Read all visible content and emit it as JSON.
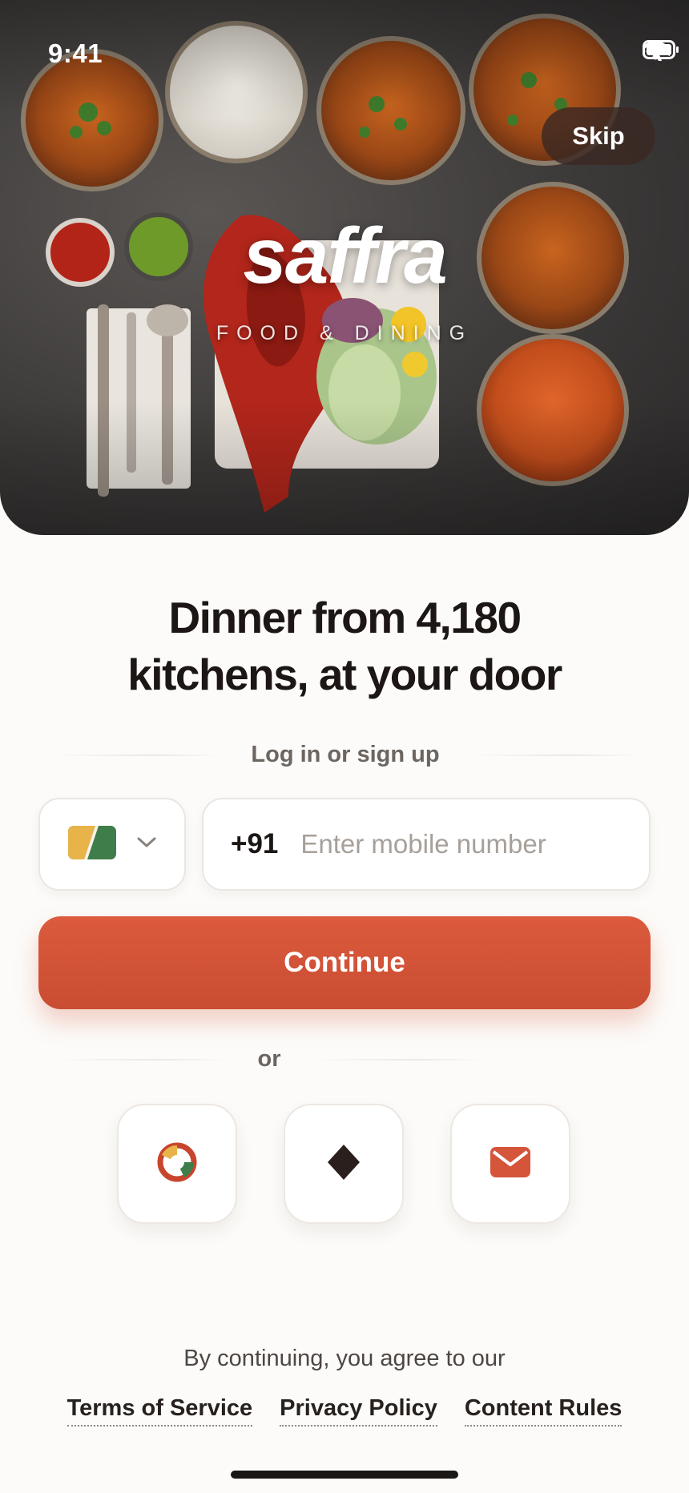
{
  "status_bar": {
    "time": "9:41",
    "icons": [
      "airplane-icon",
      "wifi-icon",
      "battery-icon"
    ]
  },
  "hero": {
    "skip_label": "Skip",
    "brand_name": "saffra",
    "brand_tagline": "FOOD & DINING"
  },
  "headline": {
    "line1": "Dinner from 4,180",
    "line2": "kitchens, at your door"
  },
  "login": {
    "divider_label": "Log in or sign up",
    "country_icon": "country-flag-icon",
    "dial_code": "+91",
    "phone_placeholder": "Enter mobile number",
    "continue_label": "Continue"
  },
  "alt_login": {
    "divider_label": "or",
    "options": [
      "google-icon",
      "apple-icon",
      "email-icon"
    ]
  },
  "legal": {
    "intro": "By continuing, you agree to our",
    "links": [
      "Terms of Service",
      "Privacy Policy",
      "Content Rules"
    ]
  },
  "colors": {
    "accent": "#d4553a",
    "background": "#fcfbf9",
    "text": "#1c1715"
  }
}
